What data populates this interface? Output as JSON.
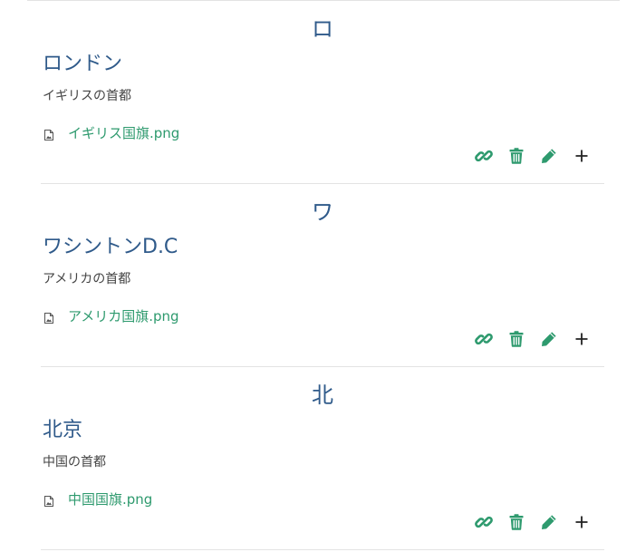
{
  "entries": [
    {
      "letter": "ロ",
      "title": "ロンドン",
      "description": "イギリスの首都",
      "file": "イギリス国旗.png"
    },
    {
      "letter": "ワ",
      "title": "ワシントンD.C",
      "description": "アメリカの首都",
      "file": "アメリカ国旗.png"
    },
    {
      "letter": "北",
      "title": "北京",
      "description": "中国の首都",
      "file": "中国国旗.png"
    }
  ],
  "icons": {
    "file": "file-image-icon",
    "link": "link-icon",
    "delete": "trash-icon",
    "edit": "pencil-icon",
    "add": "plus-icon"
  },
  "colors": {
    "heading": "#2f5a8a",
    "accent": "#2e9a6e",
    "text": "#444444",
    "divider": "#e3e3e3"
  }
}
